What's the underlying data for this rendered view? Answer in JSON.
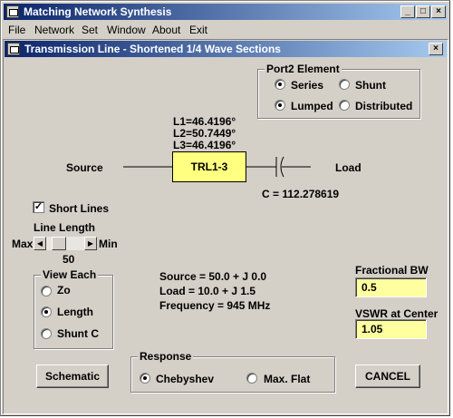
{
  "app": {
    "title": "Matching Network Synthesis"
  },
  "menu": {
    "items": [
      "File",
      "Network",
      "Set",
      "Window",
      "About",
      "Exit"
    ]
  },
  "window": {
    "title": "Transmission Line  -  Shortened 1/4 Wave Sections"
  },
  "port2": {
    "label": "Port2 Element",
    "series": "Series",
    "shunt": "Shunt",
    "lumped": "Lumped",
    "distributed": "Distributed",
    "selected_topology": "Series",
    "selected_type": "Lumped"
  },
  "circuit": {
    "l1": "L1=46.4196°",
    "l2": "L2=50.7449°",
    "l3": "L3=46.4196°",
    "source": "Source",
    "load": "Load",
    "block": "TRL1-3",
    "capacitor": "C = 112.278619"
  },
  "short_lines": {
    "label": "Short Lines",
    "checked": true
  },
  "line_length": {
    "label": "Line Length",
    "min_label": "Min",
    "max_label": "Max",
    "value": "50"
  },
  "view_each": {
    "label": "View Each",
    "zo": "Zo",
    "length": "Length",
    "shunt_c": "Shunt C",
    "selected": "Length"
  },
  "info": {
    "source": "Source = 50.0 + J 0.0",
    "load": "Load = 10.0 + J 1.5",
    "frequency": "Frequency = 945 MHz"
  },
  "fractional_bw": {
    "label": "Fractional BW",
    "value": "0.5"
  },
  "vswr": {
    "label": "VSWR at Center",
    "value": "1.05"
  },
  "response": {
    "label": "Response",
    "chebyshev": "Chebyshev",
    "max_flat": "Max. Flat",
    "selected": "Chebyshev"
  },
  "buttons": {
    "schematic": "Schematic",
    "cancel": "CANCEL"
  },
  "colors": {
    "titlebar_start": "#0a246a",
    "titlebar_end": "#a6caf0",
    "field_bg": "#ffffa0",
    "face": "#d4d0c8"
  }
}
